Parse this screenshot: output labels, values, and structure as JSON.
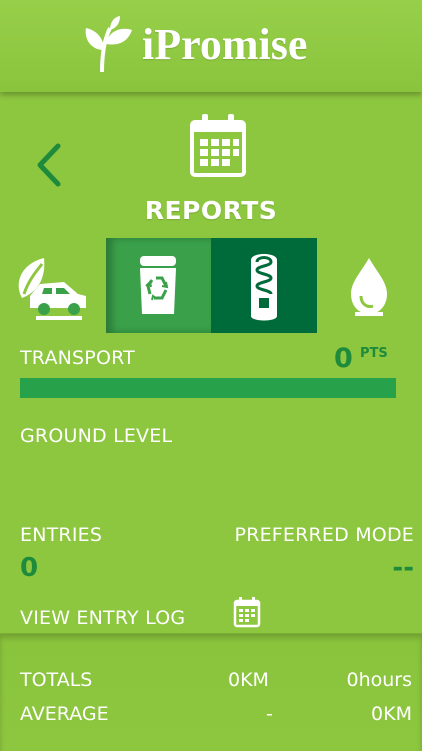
{
  "app": {
    "name": "iPromise"
  },
  "screen": {
    "title": "REPORTS"
  },
  "tabs": [
    {
      "name": "transport",
      "icon": "car-leaf-icon"
    },
    {
      "name": "recycle",
      "icon": "recycle-bin-icon"
    },
    {
      "name": "energy",
      "icon": "light-bulb-icon"
    },
    {
      "name": "water",
      "icon": "water-drop-icon"
    }
  ],
  "category": {
    "label": "TRANSPORT",
    "points": "0",
    "points_unit": "PTS",
    "progress": 1.0,
    "level": "GROUND LEVEL"
  },
  "stats": {
    "entries_label": "ENTRIES",
    "entries_value": "0",
    "preferred_mode_label": "PREFERRED MODE",
    "preferred_mode_value": "--"
  },
  "log": {
    "label": "VIEW ENTRY LOG"
  },
  "totals": {
    "label": "TOTALS",
    "distance": "0KM",
    "time": "0hours"
  },
  "average": {
    "label": "AVERAGE",
    "time": "-",
    "distance": "0KM"
  },
  "colors": {
    "background": "#8dc63f",
    "dark_green": "#1e8b3c",
    "tab_recycle": "#3aa14a",
    "tab_energy": "#006b3a"
  }
}
